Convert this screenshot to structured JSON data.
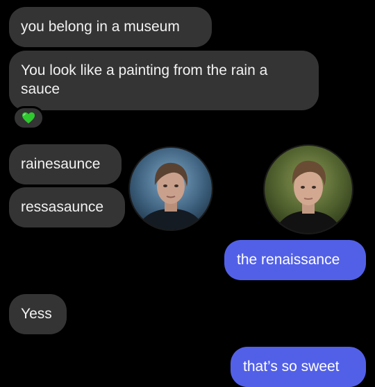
{
  "messages": [
    {
      "text": "you belong in a museum"
    },
    {
      "text": "You look like a painting from the rain a sauce",
      "line1": "You look like a painting from the rain a",
      "line2": "sauce"
    },
    {
      "text": "rainesaunce"
    },
    {
      "text": "ressasaunce"
    },
    {
      "text": "the renaissance"
    },
    {
      "text": "Yess"
    },
    {
      "text": "that’s so sweet"
    }
  ],
  "reaction": {
    "icon": "green-heart-icon",
    "color": "#2ec92e"
  },
  "colors": {
    "received": "#343435",
    "sent": "#5260e8",
    "background": "#000000"
  }
}
